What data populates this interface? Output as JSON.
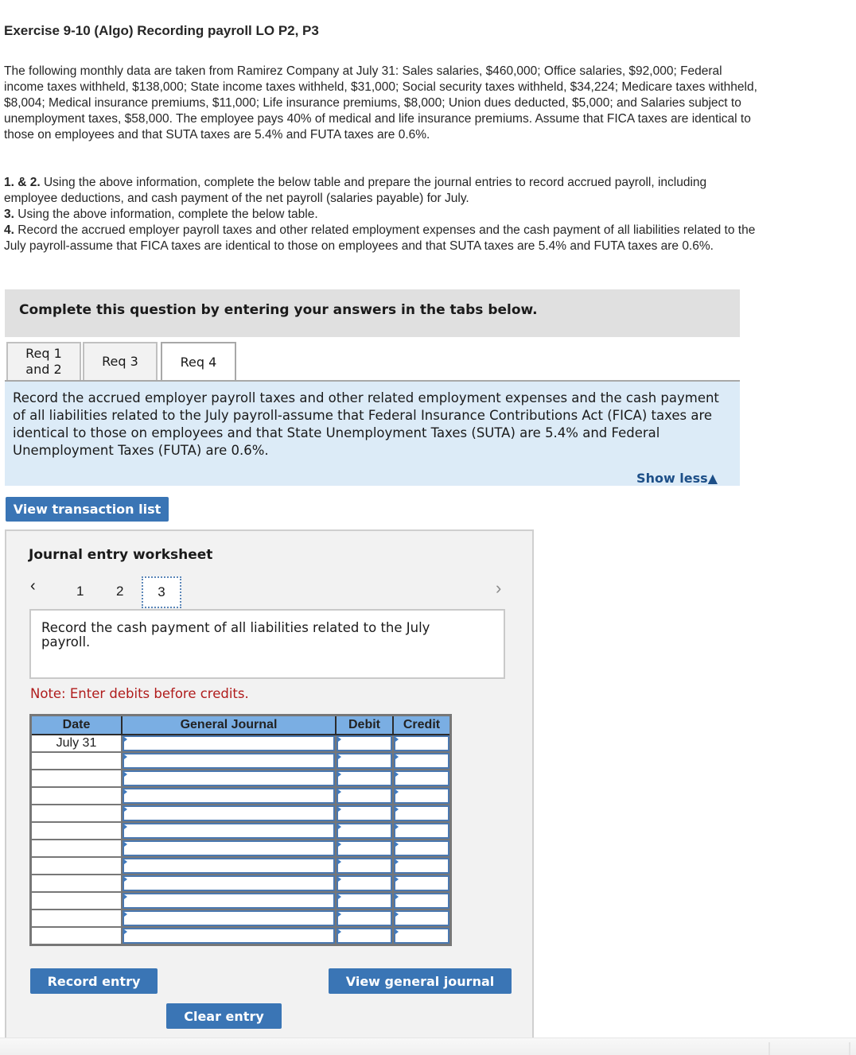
{
  "title": "Exercise 9-10 (Algo) Recording payroll LO P2, P3",
  "intro": "The following monthly data are taken from Ramirez Company at July 31: Sales salaries, $460,000; Office salaries, $92,000; Federal income taxes withheld, $138,000; State income taxes withheld, $31,000; Social security taxes withheld, $34,224; Medicare taxes withheld, $8,004; Medical insurance premiums, $11,000; Life insurance premiums, $8,000; Union dues deducted, $5,000; and Salaries subject to unemployment taxes, $58,000. The employee pays 40% of medical and life insurance premiums. Assume that FICA taxes are identical to those on employees and that SUTA taxes are 5.4% and FUTA taxes are 0.6%.",
  "requirements": [
    {
      "num": "1. & 2.",
      "text": "Using the above information, complete the below table and prepare the journal entries to record accrued payroll, including employee deductions, and cash payment of the net payroll (salaries payable) for July."
    },
    {
      "num": "3.",
      "text": "Using the above information, complete the below table."
    },
    {
      "num": "4.",
      "text": "Record the accrued employer payroll taxes and other related employment expenses and the cash payment of all liabilities related to the July payroll-assume that FICA taxes are identical to those on employees and that SUTA taxes are 5.4% and FUTA taxes are 0.6%."
    }
  ],
  "banner": "Complete this question by entering your answers in the tabs below.",
  "tabs": [
    {
      "label": "Req 1\nand 2",
      "line1": "Req 1",
      "line2": "and 2",
      "active": false
    },
    {
      "label": "Req 3",
      "active": false
    },
    {
      "label": "Req 4",
      "active": true
    }
  ],
  "tab_description": "Record the accrued employer payroll taxes and other related employment expenses and the cash payment of all liabilities related to the July payroll-assume that Federal Insurance Contributions Act (FICA) taxes are identical to those on employees and that State Unemployment Taxes (SUTA) are 5.4% and Federal Unemployment Taxes (FUTA) are 0.6%.",
  "show_less": "Show less▲",
  "view_transaction_list": "View transaction list",
  "worksheet": {
    "title": "Journal entry worksheet",
    "prev_icon": "‹",
    "next_icon": "›",
    "pages": [
      "1",
      "2",
      "3"
    ],
    "current_page": "3",
    "instruction": "Record the cash payment of all liabilities related to the July payroll.",
    "note": "Note: Enter debits before credits.",
    "columns": [
      "Date",
      "General Journal",
      "Debit",
      "Credit"
    ],
    "rows": [
      {
        "date": "July 31",
        "account": "",
        "debit": "",
        "credit": ""
      },
      {
        "date": "",
        "account": "",
        "debit": "",
        "credit": ""
      },
      {
        "date": "",
        "account": "",
        "debit": "",
        "credit": ""
      },
      {
        "date": "",
        "account": "",
        "debit": "",
        "credit": ""
      },
      {
        "date": "",
        "account": "",
        "debit": "",
        "credit": ""
      },
      {
        "date": "",
        "account": "",
        "debit": "",
        "credit": ""
      },
      {
        "date": "",
        "account": "",
        "debit": "",
        "credit": ""
      },
      {
        "date": "",
        "account": "",
        "debit": "",
        "credit": ""
      },
      {
        "date": "",
        "account": "",
        "debit": "",
        "credit": ""
      },
      {
        "date": "",
        "account": "",
        "debit": "",
        "credit": ""
      },
      {
        "date": "",
        "account": "",
        "debit": "",
        "credit": ""
      },
      {
        "date": "",
        "account": "",
        "debit": "",
        "credit": ""
      }
    ],
    "record_entry": "Record entry",
    "clear_entry": "Clear entry",
    "view_general_journal": "View general journal"
  },
  "colors": {
    "button": "#3a75b5",
    "header": "#7aaee3",
    "note": "#b01c1c",
    "link": "#1d4f88",
    "description_bg": "#dcebf7"
  }
}
